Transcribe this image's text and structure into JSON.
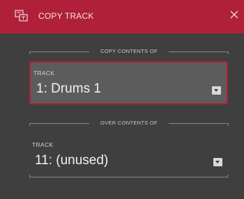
{
  "dialog": {
    "title": "COPY TRACK",
    "icon": "copy-track-icon",
    "close_icon": "close-icon"
  },
  "copy_section": {
    "heading": "COPY CONTENTS OF",
    "field_label": "TRACK",
    "value": "1: Drums 1",
    "selected": true
  },
  "over_section": {
    "heading": "OVER CONTENTS OF",
    "field_label": "TRACK",
    "value": "11: (unused)",
    "selected": false
  },
  "colors": {
    "accent": "#b02039",
    "background": "#3f3f3f",
    "selected_field": "#5c5c5c"
  }
}
